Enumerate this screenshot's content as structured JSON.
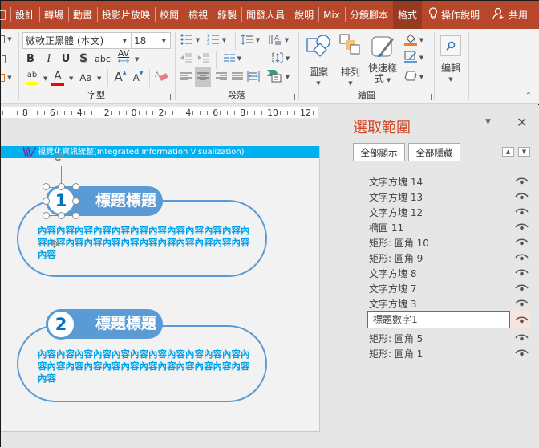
{
  "tabs": [
    {
      "label": "",
      "partial": true
    },
    {
      "label": "設計"
    },
    {
      "label": "轉場"
    },
    {
      "label": "動畫"
    },
    {
      "label": "投影片放映"
    },
    {
      "label": "校閱"
    },
    {
      "label": "檢視"
    },
    {
      "label": "錄製"
    },
    {
      "label": "開發人員"
    },
    {
      "label": "說明"
    },
    {
      "label": "Mix"
    },
    {
      "label": "分鏡腳本"
    },
    {
      "label": "格式",
      "active": true
    }
  ],
  "tell_me": {
    "icon": "lightbulb-icon",
    "label": "操作說明"
  },
  "share": {
    "icon": "person-add-icon",
    "label": "共用"
  },
  "ribbon": {
    "font_group": {
      "label": "字型",
      "font_name": "微軟正黑體 (本文)",
      "font_size": "18",
      "bold": "B",
      "italic": "I",
      "underline": "U",
      "shadow": "S",
      "strikethrough": "abc",
      "spacing": "AV",
      "highlight": "ab",
      "font_color": "A",
      "change_case": "Aa",
      "grow": "A",
      "shrink": "A",
      "highlight_color": "#ffff00",
      "font_color_value": "#ff0000"
    },
    "paragraph_group": {
      "label": "段落"
    },
    "drawing_group": {
      "label": "繪圖",
      "shapes": "圖案",
      "arrange": "排列",
      "quick_styles_1": "快速樣",
      "quick_styles_2": "式",
      "fill_color": "#ed7d31",
      "outline_color": "#5b9bd5"
    },
    "editing_group": {
      "label": "編輯"
    }
  },
  "ruler": [
    "8",
    "6",
    "4",
    "2",
    "0",
    "2",
    "4",
    "6",
    "8",
    "10",
    "12"
  ],
  "slide": {
    "header": "視覺化資訊統整(Integrated Information Visualization)",
    "logo": "W",
    "cards": [
      {
        "number": "1",
        "title": "標題標題",
        "content": "內容內容內容內容內容內容內容內容內容內容內容內容內容內容內容內容內容內容內容內容內容內容內容內容"
      },
      {
        "number": "2",
        "title": "標題標題",
        "content": "內容內容內容內容內容內容內容內容內容內容內容內容內容內容內容內容內容內容內容內容內容內容內容內容"
      }
    ]
  },
  "selection_pane": {
    "title": "選取範圍",
    "show_all": "全部顯示",
    "hide_all": "全部隱藏",
    "items": [
      {
        "label": "文字方塊 14"
      },
      {
        "label": "文字方塊 13"
      },
      {
        "label": "文字方塊 12"
      },
      {
        "label": "橢圓 11"
      },
      {
        "label": "矩形: 圓角 10"
      },
      {
        "label": "矩形: 圓角 9"
      },
      {
        "label": "文字方塊 8"
      },
      {
        "label": "文字方塊 7"
      },
      {
        "label": "文字方塊 3"
      },
      {
        "label": "標題數字1",
        "editing": true
      },
      {
        "label": "矩形: 圓角 5"
      },
      {
        "label": "矩形: 圓角 1"
      }
    ]
  },
  "colors": {
    "tab_bar": "#b7472a",
    "accent": "#d24726",
    "card_blue": "#5b9bd5",
    "content_text": "#00a0e9",
    "header_bar": "#00b0f0"
  }
}
